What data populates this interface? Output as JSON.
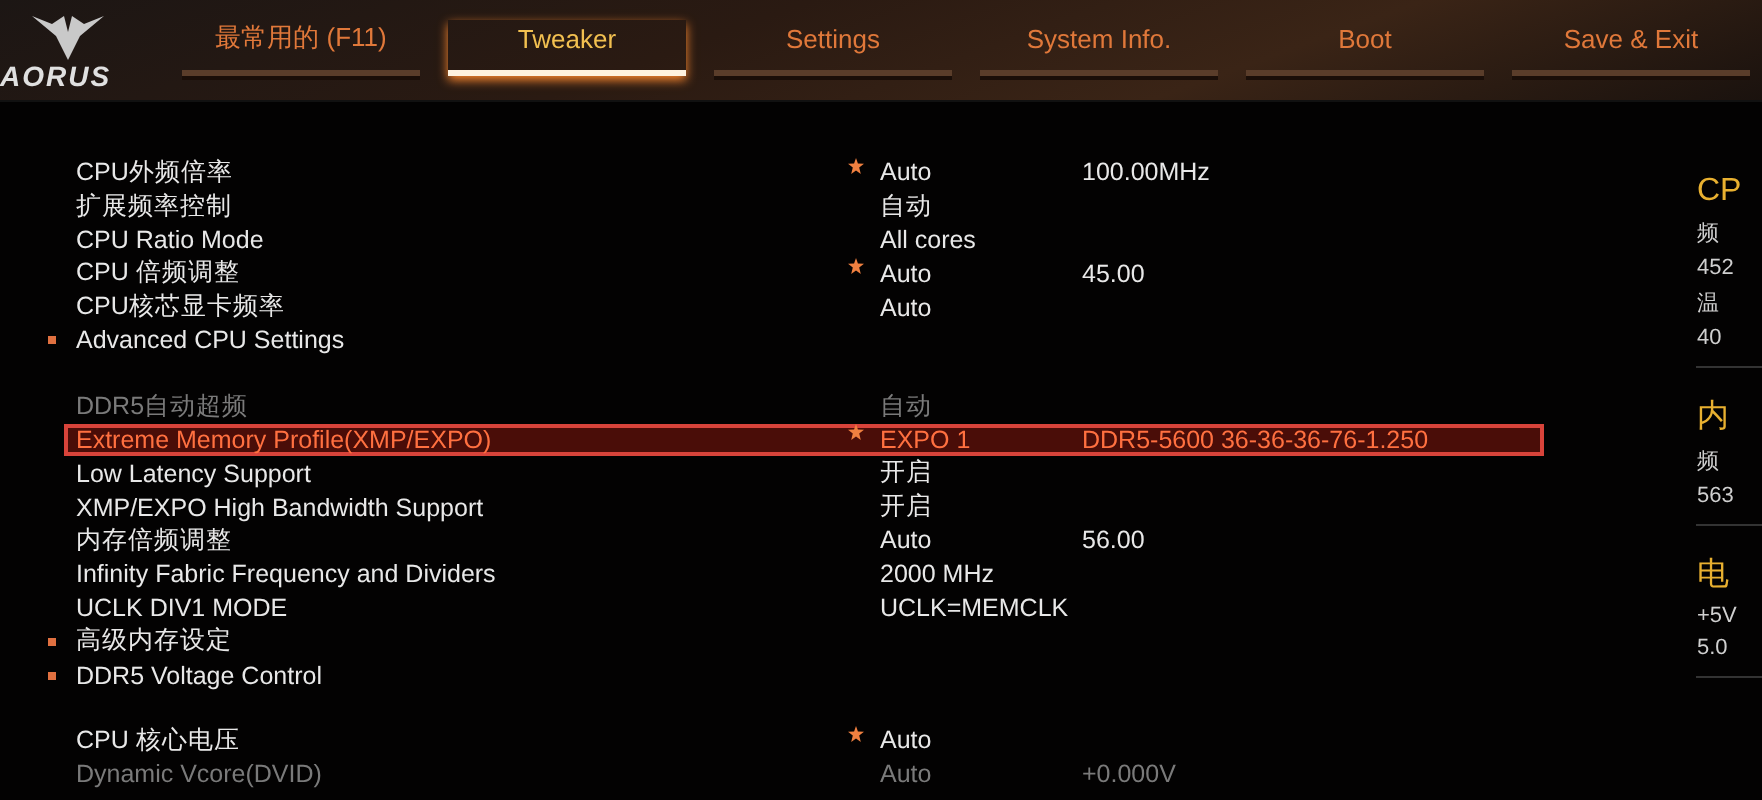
{
  "logo": {
    "text": "AORUS"
  },
  "tabs": [
    {
      "label": "最常用的 (F11)",
      "selected": false
    },
    {
      "label": "Tweaker",
      "selected": true
    },
    {
      "label": "Settings",
      "selected": false
    },
    {
      "label": "System Info.",
      "selected": false
    },
    {
      "label": "Boot",
      "selected": false
    },
    {
      "label": "Save & Exit",
      "selected": false
    }
  ],
  "groups": [
    {
      "rows": [
        {
          "kind": "setting",
          "label": "CPU外频倍率",
          "starred": true,
          "value": "Auto",
          "detail": "100.00MHz",
          "disabled": false,
          "selected": false
        },
        {
          "kind": "setting",
          "label": "扩展频率控制",
          "starred": false,
          "value": "自动",
          "disabled": false,
          "selected": false
        },
        {
          "kind": "setting",
          "label": "CPU Ratio Mode",
          "starred": false,
          "value": "All cores",
          "disabled": false,
          "selected": false
        },
        {
          "kind": "setting",
          "label": "CPU 倍频调整",
          "starred": true,
          "value": "Auto",
          "detail": "45.00",
          "disabled": false,
          "selected": false
        },
        {
          "kind": "setting",
          "label": "CPU核芯显卡频率",
          "starred": false,
          "value": "Auto",
          "disabled": false,
          "selected": false
        },
        {
          "kind": "submenu",
          "label": "Advanced CPU Settings"
        }
      ]
    },
    {
      "rows": [
        {
          "kind": "setting",
          "label": "DDR5自动超频",
          "starred": false,
          "value": "自动",
          "disabled": true,
          "selected": false
        },
        {
          "kind": "setting",
          "label": "Extreme Memory Profile(XMP/EXPO)",
          "starred": true,
          "value": "EXPO 1",
          "detail": "DDR5-5600 36-36-36-76-1.250",
          "disabled": false,
          "selected": true
        },
        {
          "kind": "setting",
          "label": "Low Latency Support",
          "starred": false,
          "value": "开启",
          "disabled": false,
          "selected": false
        },
        {
          "kind": "setting",
          "label": "XMP/EXPO High Bandwidth Support",
          "starred": false,
          "value": "开启",
          "disabled": false,
          "selected": false
        },
        {
          "kind": "setting",
          "label": "内存倍频调整",
          "starred": false,
          "value": "Auto",
          "detail": "56.00",
          "disabled": false,
          "selected": false
        },
        {
          "kind": "setting",
          "label": "Infinity Fabric Frequency and Dividers",
          "starred": false,
          "value": "2000 MHz",
          "disabled": false,
          "selected": false
        },
        {
          "kind": "setting",
          "label": "UCLK DIV1 MODE",
          "starred": false,
          "value": "UCLK=MEMCLK",
          "disabled": false,
          "selected": false
        },
        {
          "kind": "submenu",
          "label": "高级内存设定"
        },
        {
          "kind": "submenu",
          "label": "DDR5 Voltage Control"
        }
      ]
    },
    {
      "rows": [
        {
          "kind": "setting",
          "label": "CPU 核心电压",
          "starred": true,
          "value": "Auto",
          "disabled": false,
          "selected": false
        },
        {
          "kind": "setting",
          "label": "Dynamic Vcore(DVID)",
          "starred": false,
          "value": "Auto",
          "detail": "+0.000V",
          "disabled": true,
          "selected": false
        }
      ]
    }
  ],
  "side_panel": [
    {
      "title": "CP",
      "lines": [
        "频",
        "452",
        "温",
        "40"
      ]
    },
    {
      "title": "内",
      "lines": [
        "频",
        "563"
      ]
    },
    {
      "title": "电",
      "lines": [
        "+5V",
        "5.0"
      ]
    }
  ]
}
